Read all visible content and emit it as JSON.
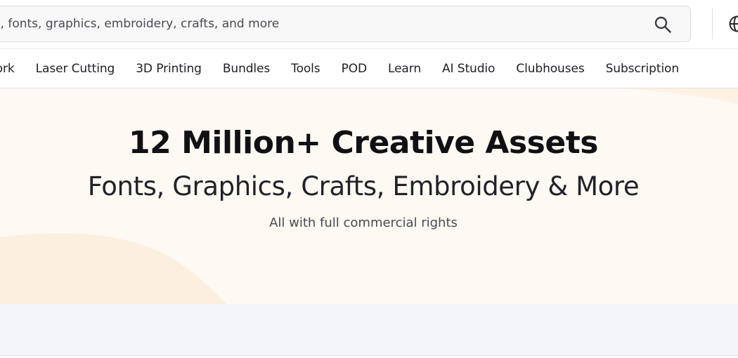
{
  "search": {
    "placeholder": "ts, fonts, graphics, embroidery, crafts, and more",
    "icon": "search-icon"
  },
  "header": {
    "globe_icon": "globe-icon"
  },
  "nav": {
    "items": [
      {
        "label": "Work"
      },
      {
        "label": "Laser Cutting"
      },
      {
        "label": "3D Printing"
      },
      {
        "label": "Bundles"
      },
      {
        "label": "Tools"
      },
      {
        "label": "POD"
      },
      {
        "label": "Learn"
      },
      {
        "label": "AI Studio"
      },
      {
        "label": "Clubhouses"
      },
      {
        "label": "Subscription"
      }
    ]
  },
  "hero": {
    "title": "12 Million+ Creative Assets",
    "subtitle": "Fonts, Graphics, Crafts, Embroidery & More",
    "tagline": "All with full commercial rights"
  },
  "colors": {
    "hero_background": "#fff9f3",
    "hero_shape": "#fdf0e1",
    "band_background": "#f4f5f9"
  }
}
